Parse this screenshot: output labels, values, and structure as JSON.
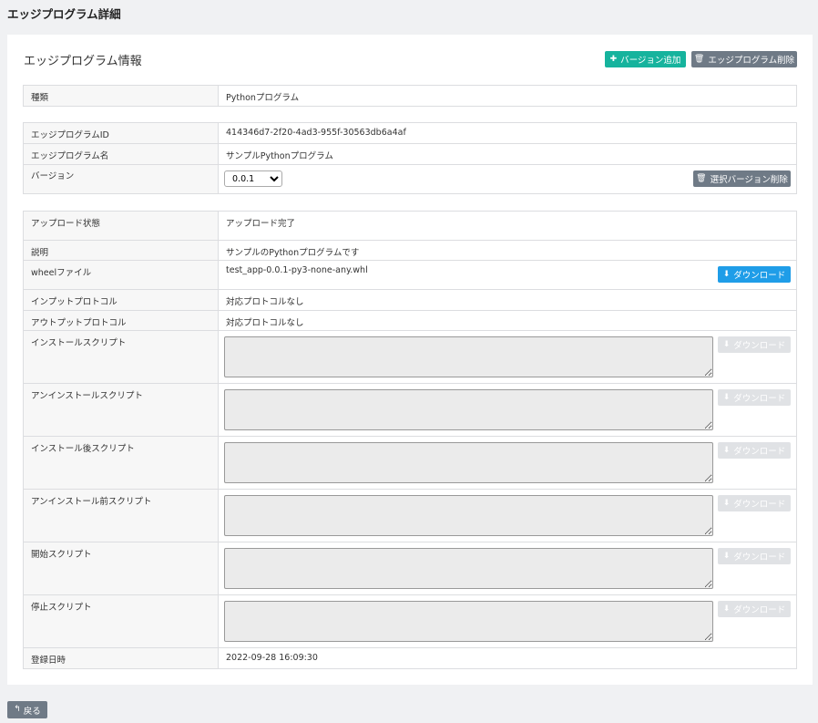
{
  "page": {
    "title": "エッジプログラム詳細"
  },
  "card": {
    "title": "エッジプログラム情報",
    "add_version_label": "バージョン追加",
    "delete_program_label": "エッジプログラム削除"
  },
  "type_row": {
    "label": "種類",
    "value": "Pythonプログラム"
  },
  "id_row": {
    "label": "エッジプログラムID",
    "value": "414346d7-2f20-4ad3-955f-30563db6a4af"
  },
  "name_row": {
    "label": "エッジプログラム名",
    "value": "サンプルPythonプログラム"
  },
  "version_row": {
    "label": "バージョン",
    "selected": "0.0.1",
    "delete_version_label": "選択バージョン削除"
  },
  "upload_row": {
    "label": "アップロード状態",
    "value": "アップロード完了"
  },
  "desc_row": {
    "label": "説明",
    "value": "サンプルのPythonプログラムです"
  },
  "wheel_row": {
    "label": "wheelファイル",
    "value": "test_app-0.0.1-py3-none-any.whl",
    "download_label": "ダウンロード"
  },
  "input_row": {
    "label": "インプットプロトコル",
    "value": "対応プロトコルなし"
  },
  "output_row": {
    "label": "アウトプットプロトコル",
    "value": "対応プロトコルなし"
  },
  "scripts": [
    {
      "label": "インストールスクリプト",
      "download_label": "ダウンロード"
    },
    {
      "label": "アンインストールスクリプト",
      "download_label": "ダウンロード"
    },
    {
      "label": "インストール後スクリプト",
      "download_label": "ダウンロード"
    },
    {
      "label": "アンインストール前スクリプト",
      "download_label": "ダウンロード"
    },
    {
      "label": "開始スクリプト",
      "download_label": "ダウンロード"
    },
    {
      "label": "停止スクリプト",
      "download_label": "ダウンロード"
    }
  ],
  "registered_row": {
    "label": "登録日時",
    "value": "2022-09-28 16:09:30"
  },
  "back_label": "戻る",
  "colors": {
    "teal": "#16b39d",
    "gray": "#6f7a86",
    "blue": "#1f9de8",
    "disabled": "#e0e2e5"
  }
}
